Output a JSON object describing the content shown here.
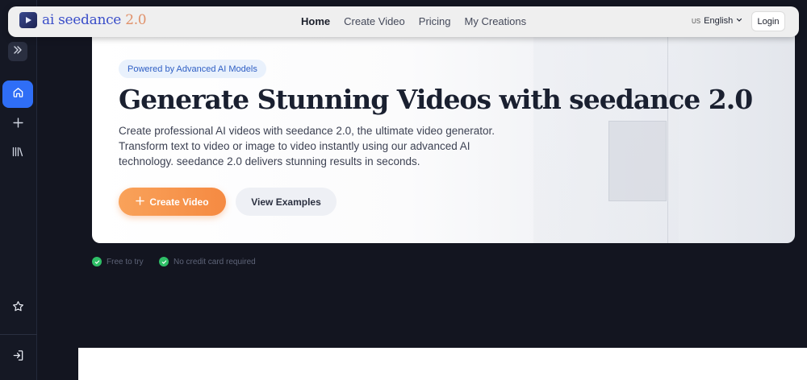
{
  "sidebar": {
    "items": [
      {
        "name": "expand",
        "icon": "chevrons-right-icon"
      },
      {
        "name": "home",
        "icon": "home-icon",
        "active": true
      },
      {
        "name": "new",
        "icon": "plus-icon"
      },
      {
        "name": "library",
        "icon": "library-icon"
      },
      {
        "name": "favorites",
        "icon": "star-icon"
      },
      {
        "name": "login",
        "icon": "login-icon"
      }
    ]
  },
  "header": {
    "brand_name": "ai seedance",
    "brand_version": "2.0",
    "nav": [
      "Home",
      "Create Video",
      "Pricing",
      "My Creations"
    ],
    "active_nav": "Home",
    "language_flag": "US",
    "language": "English",
    "login_label": "Login"
  },
  "hero": {
    "badge": "Powered by Advanced AI Models",
    "title": "Generate Stunning Videos with seedance 2.0",
    "description": "Create professional AI videos with seedance 2.0, the ultimate video generator. Transform text to video or image to video instantly using our advanced AI technology. seedance 2.0 delivers stunning results in seconds.",
    "primary_button": "Create Video",
    "secondary_button": "View Examples"
  },
  "trust": [
    "Free to try",
    "No credit card required"
  ],
  "colors": {
    "accent": "#2f6ef6",
    "cta_orange": "#f58a42",
    "check_green": "#2fbf67",
    "background": "#131520"
  }
}
